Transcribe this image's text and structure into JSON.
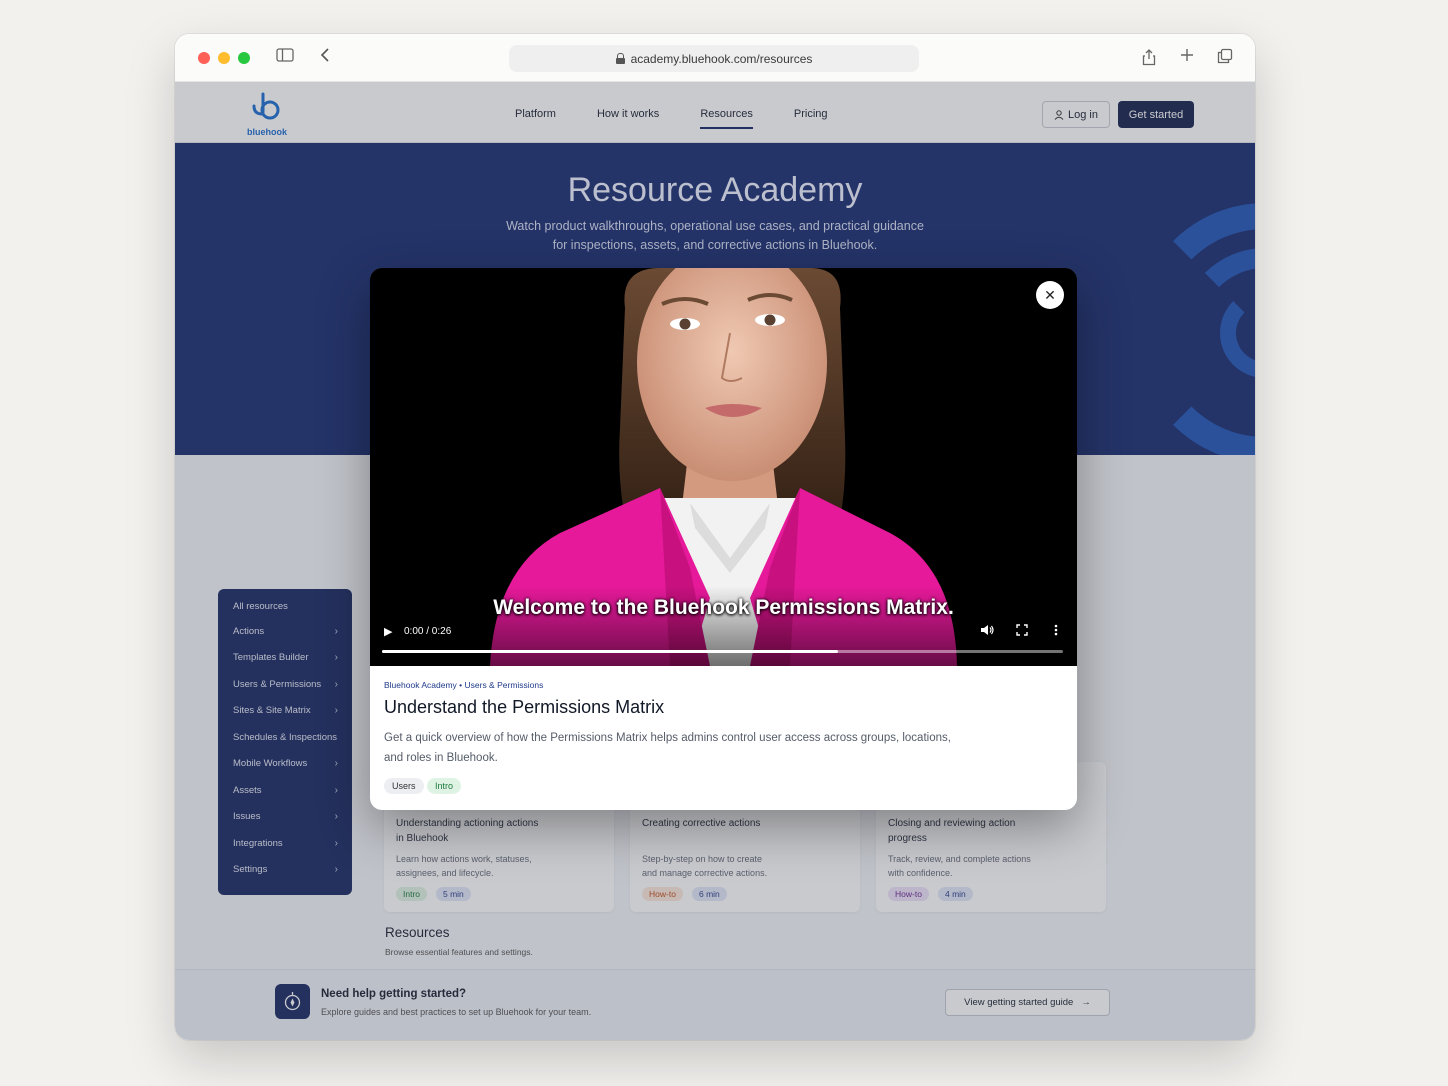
{
  "browser": {
    "url": "academy.bluehook.com/resources"
  },
  "nav": {
    "logo_text": "bluehook",
    "links": [
      "Platform",
      "How it works",
      "Resources",
      "Pricing"
    ],
    "login": "Log in",
    "get_started": "Get started"
  },
  "hero": {
    "title": "Resource Academy",
    "subtitle_line1": "Watch product walkthroughs, operational use cases, and practical guidance",
    "subtitle_line2": "for inspections, assets, and corrective actions in Bluehook."
  },
  "sidebar": {
    "items": [
      "All resources",
      "Actions",
      "Templates Builder",
      "Users & Permissions",
      "Sites & Site Matrix",
      "Schedules & Inspections",
      "Mobile Workflows",
      "Assets",
      "Issues",
      "Integrations",
      "Settings"
    ]
  },
  "cards": [
    {
      "title_line1": "Understanding actioning actions",
      "title_line2": "in Bluehook",
      "desc_line1": "Learn how actions work, statuses,",
      "desc_line2": "assignees, and lifecycle.",
      "tag": "Intro",
      "duration": "5 min"
    },
    {
      "title_line1": "Creating corrective actions",
      "title_line2": "",
      "desc_line1": "Step-by-step on how to create",
      "desc_line2": "and manage corrective actions.",
      "tag": "How-to",
      "duration": "6 min"
    },
    {
      "title_line1": "Closing and reviewing action",
      "title_line2": "progress",
      "desc_line1": "Track, review, and complete actions",
      "desc_line2": "with confidence.",
      "tag": "How-to",
      "duration": "4 min"
    }
  ],
  "resources_section": {
    "title": "Resources",
    "subtitle": "Browse essential features and settings."
  },
  "help": {
    "title": "Need help getting started?",
    "subtitle": "Explore guides and best practices to set up Bluehook for your team.",
    "button": "View getting started guide"
  },
  "modal": {
    "caption": "Welcome to the Bluehook Permissions Matrix.",
    "time": "0:00 / 0:26",
    "progress": 0.67,
    "breadcrumb_1": "Bluehook Academy",
    "breadcrumb_2": "Users & Permissions",
    "title": "Understand the Permissions Matrix",
    "desc_line1": "Get a quick overview of how the Permissions Matrix helps admins control user access across groups, locations,",
    "desc_line2": "and roles in Bluehook.",
    "tags": [
      "Users",
      "Intro"
    ]
  },
  "colors": {
    "brand_navy": "#1b2a63",
    "hero_blue": "#1b2f72",
    "accent_blue": "#1f6fd0",
    "blazer_pink": "#e6199a"
  }
}
